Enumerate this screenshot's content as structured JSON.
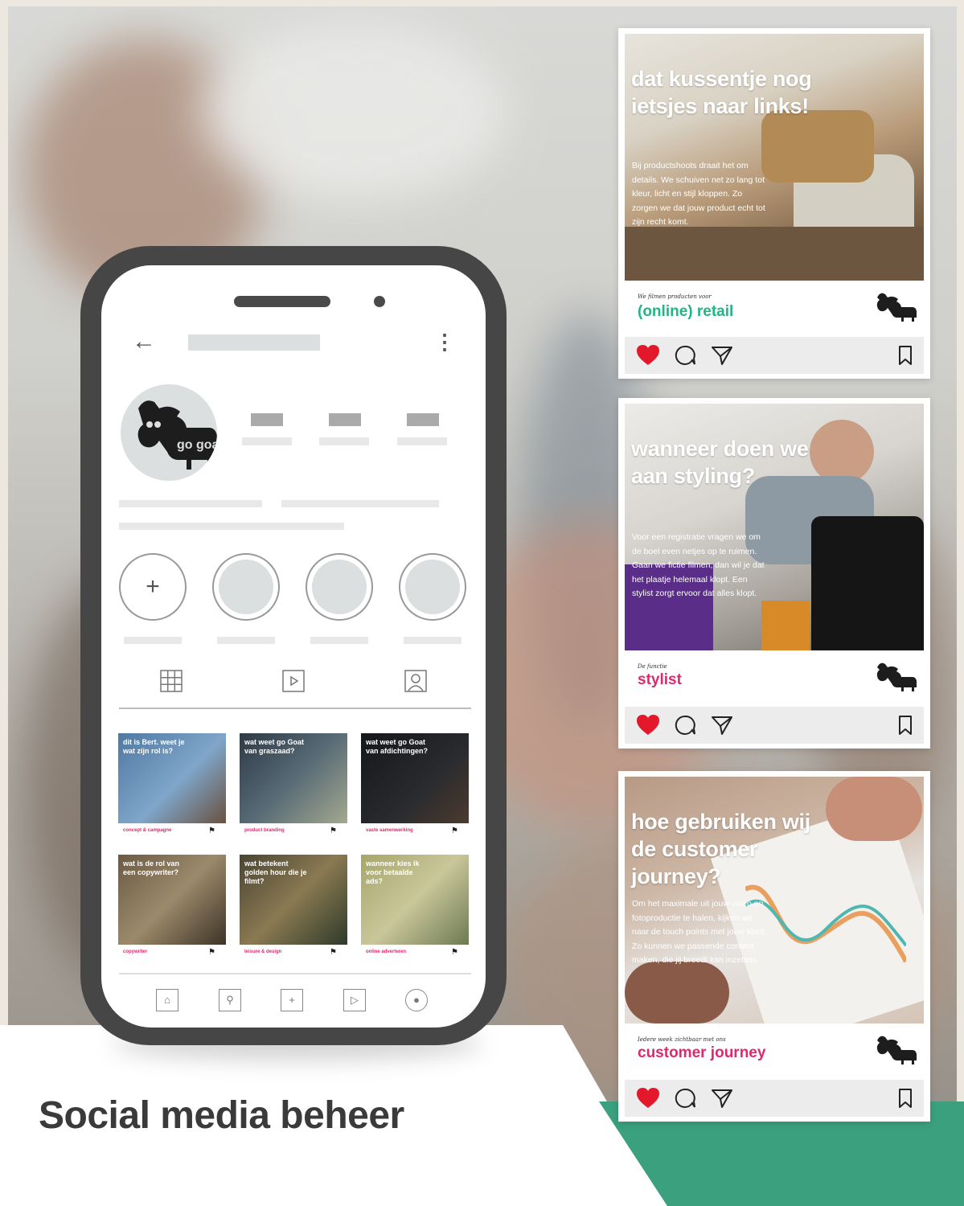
{
  "page": {
    "title": "Social media beheer"
  },
  "profile": {
    "avatar_logo_text": "go goat",
    "grid_posts": [
      {
        "caption": "dit is Bert. weet je wat zijn rol is?",
        "tag": "concept & campagne"
      },
      {
        "caption": "wat weet go Goat van graszaad?",
        "tag": "product branding"
      },
      {
        "caption": "wat weet go Goat van afdichtingen?",
        "tag": "vaste samenwerking"
      },
      {
        "caption": "wat is de rol van een copywriter?",
        "tag": "copywriter"
      },
      {
        "caption": "wat betekent golden hour die je filmt?",
        "tag": "leisure & design"
      },
      {
        "caption": "wanneer kies ik voor betaalde ads?",
        "tag": "online adverteren"
      }
    ]
  },
  "cards": [
    {
      "headline": "dat kussentje nog ietsjes naar links!",
      "body": "Bij productshoots draait het om details. We schuiven net zo lang tot kleur, licht en stijl kloppen. Zo zorgen we dat jouw product echt tot zijn recht komt.",
      "tagline": "We filmen producten voor",
      "category": "(online) retail",
      "category_color": "#1fb584"
    },
    {
      "headline": "wanneer doen we aan styling?",
      "body": "Voor een registratie vragen we om de boel even netjes op te ruimen. Gaan we fictie filmen, dan wil je dat het plaatje helemaal klopt. Een stylist zorgt ervoor dat alles klopt.",
      "tagline": "De functie",
      "category": "stylist",
      "category_color": "#e0286e"
    },
    {
      "headline": "hoe gebruiken wij de customer journey?",
      "body": "Om het maximale uit jouw video en fotoproductie te halen, kijken we naar de touch points met jouw klant. Zo kunnen we passende content maken, die jij breedt kan inzetten.",
      "tagline": "Iedere week zichtbaar met ons",
      "category": "customer journey",
      "category_color": "#e0286e"
    }
  ],
  "colors": {
    "accent_green": "#3aa07d",
    "heart_red": "#e3192b",
    "phone_frame": "#464646"
  },
  "icons": [
    "back-arrow-icon",
    "kebab-menu-icon",
    "plus-icon",
    "grid-icon",
    "reels-icon",
    "tagged-icon",
    "home-icon",
    "search-icon",
    "add-icon",
    "play-icon",
    "profile-icon",
    "heart-icon",
    "comment-icon",
    "share-icon",
    "bookmark-icon"
  ]
}
